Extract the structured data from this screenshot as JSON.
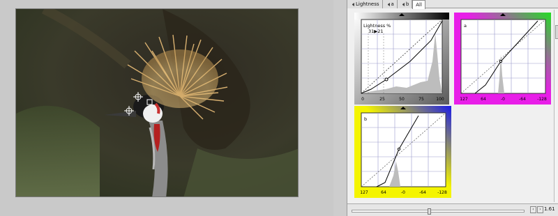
{
  "tabs": [
    {
      "label": "Lightness",
      "icon": "curve-icon"
    },
    {
      "label": "a",
      "icon": "curve-icon"
    },
    {
      "label": "b",
      "icon": "curve-icon"
    },
    {
      "label": "All",
      "icon": ""
    }
  ],
  "lightness_panel": {
    "title": "Lightness %",
    "readout": "31▶21",
    "axis_labels": [
      "0",
      "25",
      "50",
      "75",
      "100"
    ]
  },
  "a_panel": {
    "title": "a",
    "axis_labels": [
      "127",
      "64",
      "-0",
      "-64",
      "-128"
    ]
  },
  "b_panel": {
    "title": "b",
    "axis_labels": [
      "127",
      "64",
      "-0",
      "-64",
      "-128"
    ]
  },
  "zoom": {
    "value": "1.61",
    "slider_fraction": 0.44
  },
  "colors": {
    "magenta": "#e81ee8",
    "green": "#22dd22",
    "yellow": "#f4f400",
    "blue": "#1a1ae8"
  }
}
